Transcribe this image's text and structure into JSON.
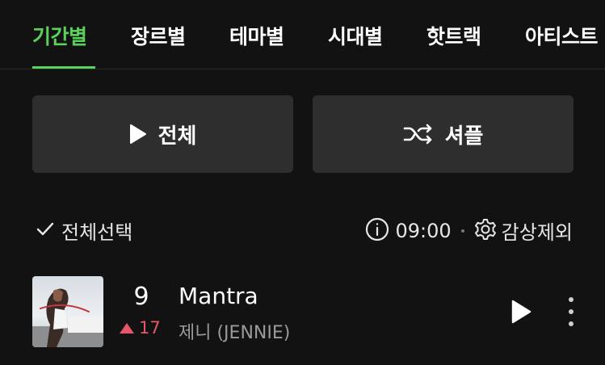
{
  "tabs": [
    {
      "label": "기간별",
      "active": true
    },
    {
      "label": "장르별",
      "active": false
    },
    {
      "label": "테마별",
      "active": false
    },
    {
      "label": "시대별",
      "active": false
    },
    {
      "label": "핫트랙",
      "active": false
    },
    {
      "label": "아티스트",
      "active": false
    }
  ],
  "actions": {
    "play_all_label": "전체",
    "shuffle_label": "셔플"
  },
  "toolbar": {
    "select_all_label": "전체선택",
    "time": "09:00",
    "exclude_label": "감상제외"
  },
  "songs": [
    {
      "rank": "9",
      "change": "17",
      "change_direction": "up",
      "title": "Mantra",
      "artist": "제니 (JENNIE)"
    }
  ],
  "colors": {
    "accent": "#5ad25a",
    "rank_up": "#e8556b",
    "background": "#121212",
    "button_bg": "#2e2e2e"
  },
  "icons": [
    "play-icon",
    "shuffle-icon",
    "check-icon",
    "info-icon",
    "gear-icon",
    "more-icon"
  ]
}
